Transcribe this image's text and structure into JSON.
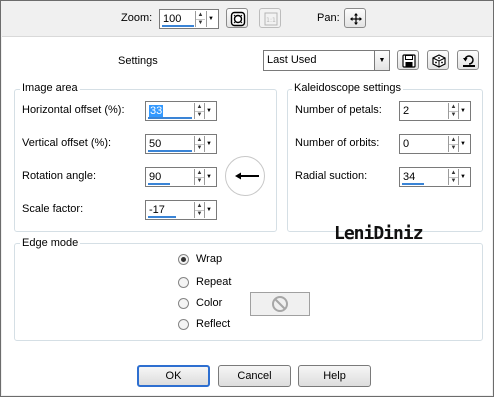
{
  "toolbar": {
    "zoom_label": "Zoom:",
    "zoom_value": "100",
    "pan_label": "Pan:"
  },
  "settings": {
    "label": "Settings",
    "preset_value": "Last Used"
  },
  "image_area": {
    "title": "Image area",
    "horizontal_offset_label": "Horizontal offset (%):",
    "horizontal_offset_value": "33",
    "vertical_offset_label": "Vertical offset (%):",
    "vertical_offset_value": "50",
    "rotation_angle_label": "Rotation angle:",
    "rotation_angle_value": "90",
    "scale_factor_label": "Scale factor:",
    "scale_factor_value": "-17"
  },
  "kaleidoscope": {
    "title": "Kaleidoscope settings",
    "petals_label": "Number of petals:",
    "petals_value": "2",
    "orbits_label": "Number of orbits:",
    "orbits_value": "0",
    "suction_label": "Radial suction:",
    "suction_value": "34"
  },
  "edge_mode": {
    "title": "Edge mode",
    "options": [
      "Wrap",
      "Repeat",
      "Color",
      "Reflect"
    ],
    "selected": "Wrap"
  },
  "buttons": {
    "ok": "OK",
    "cancel": "Cancel",
    "help": "Help"
  },
  "watermark_text": "LeniDiniz",
  "icons": [
    "proof-toggle-icon",
    "actual-size-icon",
    "pan-move-icon",
    "save-preset-icon",
    "randomize-icon",
    "reset-icon",
    "none-color-icon"
  ]
}
